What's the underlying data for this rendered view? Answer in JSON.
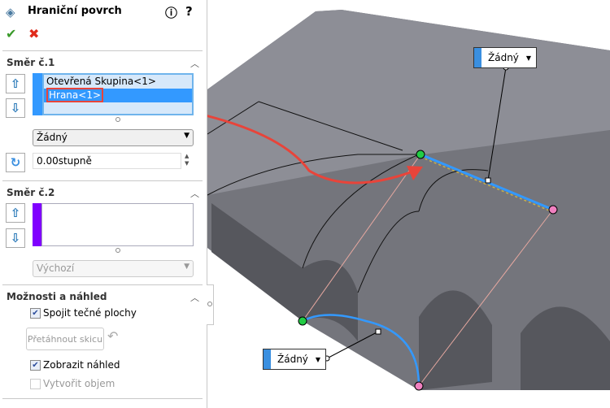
{
  "panel": {
    "title": "Hraniční povrch",
    "direction1": {
      "heading": "Směr č.1",
      "items": [
        "Otevřená Skupina<1>",
        "Hrana<1>"
      ],
      "tangency": "Žádný",
      "angle": "0.00stupně"
    },
    "direction2": {
      "heading": "Směr č.2",
      "tangency": "Výchozí"
    },
    "options": {
      "heading": "Možnosti a náhled",
      "merge_tangent": "Spojit tečné plochy",
      "drag_sketch": "Přetáhnout skicu",
      "show_preview": "Zobrazit náhled",
      "create_solid": "Vytvořit objem"
    }
  },
  "viewport": {
    "callout_top": "Žádný",
    "callout_bottom": "Žádný"
  },
  "colors": {
    "accent": "#3399ff",
    "arrow": "#e8443a",
    "dir2": "#8000ff"
  }
}
